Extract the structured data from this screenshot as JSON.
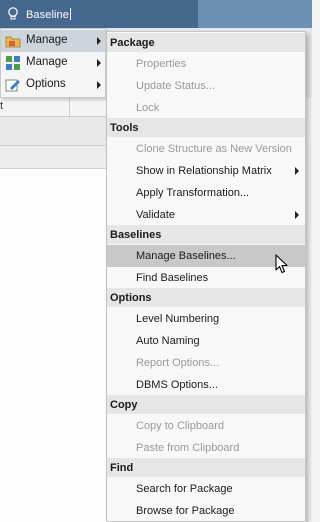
{
  "search": {
    "text": "Baseline"
  },
  "background": {
    "column_fragment": "t"
  },
  "menu1": {
    "items": [
      {
        "label": "Manage",
        "highlighted": true,
        "icon": "package-folder-icon"
      },
      {
        "label": "Manage",
        "highlighted": false,
        "icon": "diagram-elements-icon"
      },
      {
        "label": "Options",
        "highlighted": false,
        "icon": "options-edit-icon"
      }
    ]
  },
  "submenu": {
    "sections": [
      {
        "title": "Package",
        "items": [
          {
            "label": "Properties",
            "disabled": true
          },
          {
            "label": "Update Status...",
            "disabled": true
          },
          {
            "label": "Lock",
            "disabled": true
          }
        ]
      },
      {
        "title": "Tools",
        "items": [
          {
            "label": "Clone Structure as New Version",
            "disabled": true
          },
          {
            "label": "Show in Relationship Matrix",
            "submenu": true
          },
          {
            "label": "Apply Transformation..."
          },
          {
            "label": "Validate",
            "submenu": true
          }
        ]
      },
      {
        "title": "Baselines",
        "items": [
          {
            "label": "Manage Baselines...",
            "highlighted": true
          },
          {
            "label": "Find Baselines"
          }
        ]
      },
      {
        "title": "Options",
        "items": [
          {
            "label": "Level Numbering"
          },
          {
            "label": "Auto Naming"
          },
          {
            "label": "Report Options...",
            "disabled": true
          },
          {
            "label": "DBMS Options..."
          }
        ]
      },
      {
        "title": "Copy",
        "items": [
          {
            "label": "Copy to Clipboard",
            "disabled": true
          },
          {
            "label": "Paste from Clipboard",
            "disabled": true
          }
        ]
      },
      {
        "title": "Find",
        "items": [
          {
            "label": "Search for Package"
          },
          {
            "label": "Browse for Package"
          }
        ]
      }
    ]
  },
  "colors": {
    "search_bar": "#46688f",
    "menu_highlight": "#c8c8c8",
    "disabled_text": "#9a9a9a",
    "header_bg": "#e6e6e6"
  }
}
